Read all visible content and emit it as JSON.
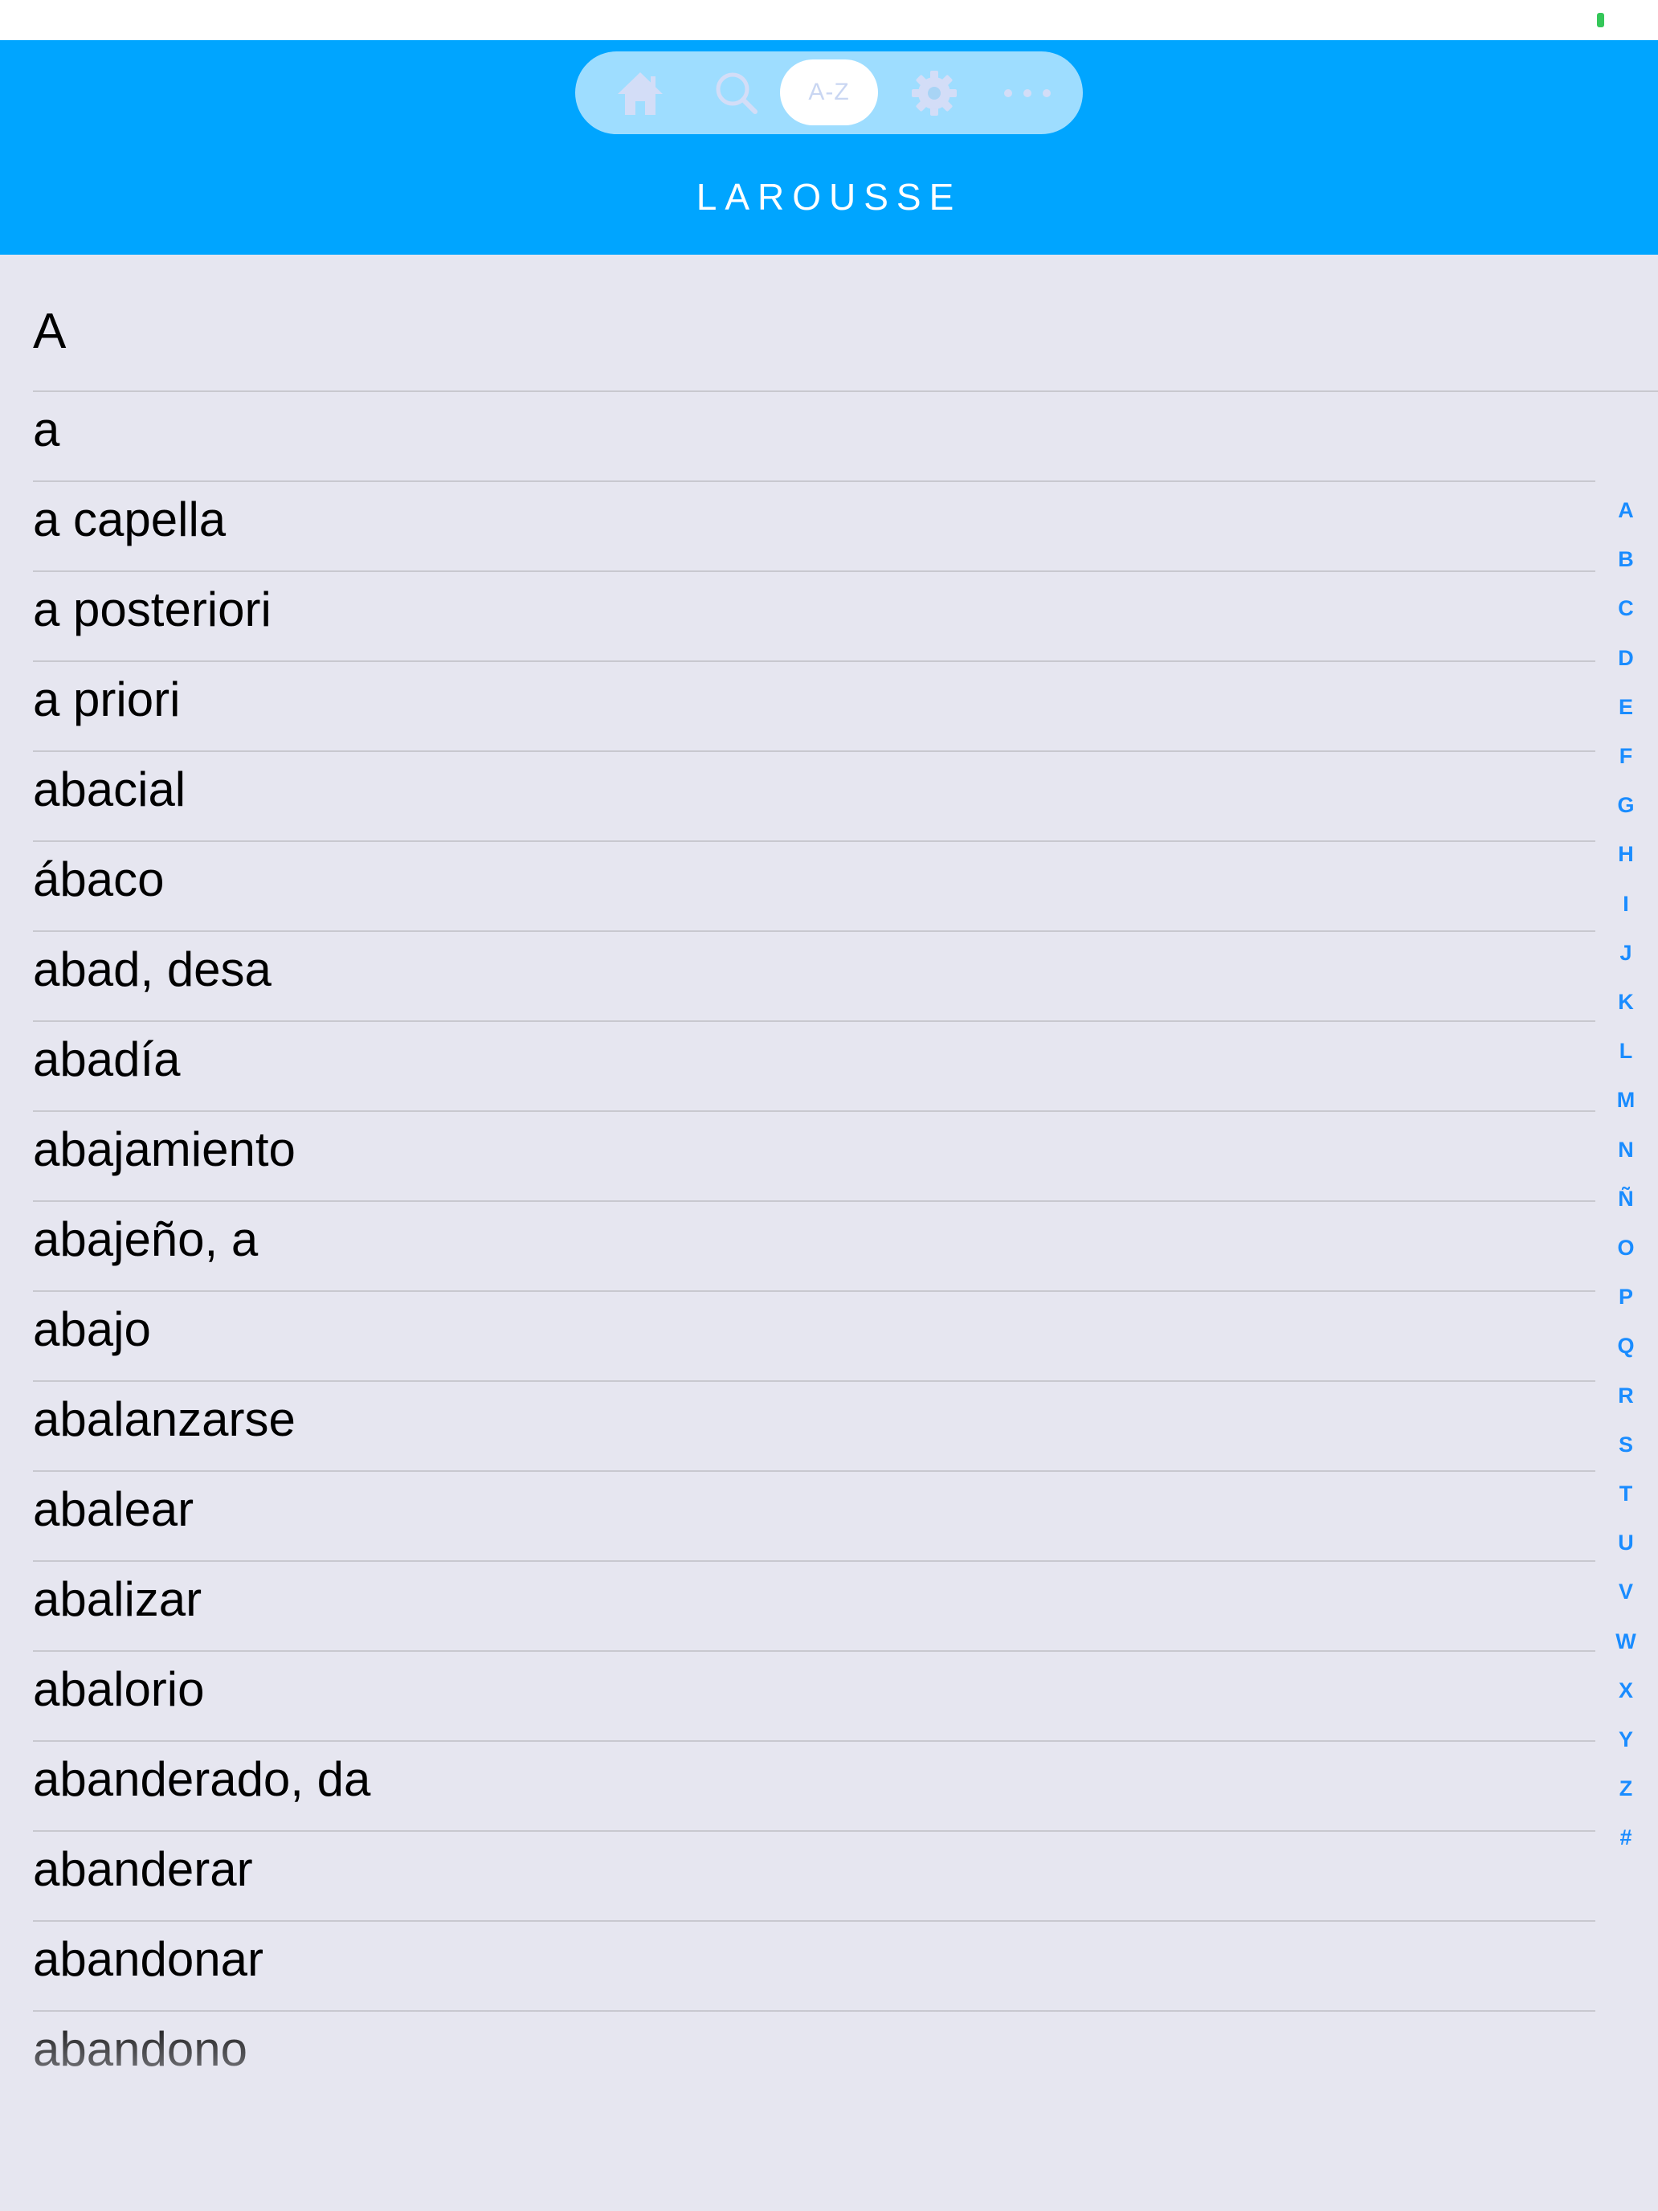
{
  "header": {
    "brand": "LAROUSSE",
    "tabs": [
      {
        "name": "home",
        "icon": "home-icon"
      },
      {
        "name": "search",
        "icon": "search-icon"
      },
      {
        "name": "az",
        "label": "A-Z",
        "selected": true
      },
      {
        "name": "settings",
        "icon": "gear-icon"
      },
      {
        "name": "more",
        "icon": "more-icon"
      }
    ]
  },
  "list": {
    "section": "A",
    "items": [
      "a",
      "a capella",
      "a posteriori",
      "a priori",
      "abacial",
      "ábaco",
      "abad, desa",
      "abadía",
      "abajamiento",
      "abajeño, a",
      "abajo",
      "abalanzarse",
      "abalear",
      "abalizar",
      "abalorio",
      "abanderado, da",
      "abanderar",
      "abandonar",
      "abandono"
    ]
  },
  "index": [
    "A",
    "B",
    "C",
    "D",
    "E",
    "F",
    "G",
    "H",
    "I",
    "J",
    "K",
    "L",
    "M",
    "N",
    "Ñ",
    "O",
    "P",
    "Q",
    "R",
    "S",
    "T",
    "U",
    "V",
    "W",
    "X",
    "Y",
    "Z",
    "#"
  ],
  "colors": {
    "header_bg": "#00a5ff",
    "page_bg": "#e6e6f0",
    "index_text": "#1a8cff",
    "battery": "#34c759"
  }
}
